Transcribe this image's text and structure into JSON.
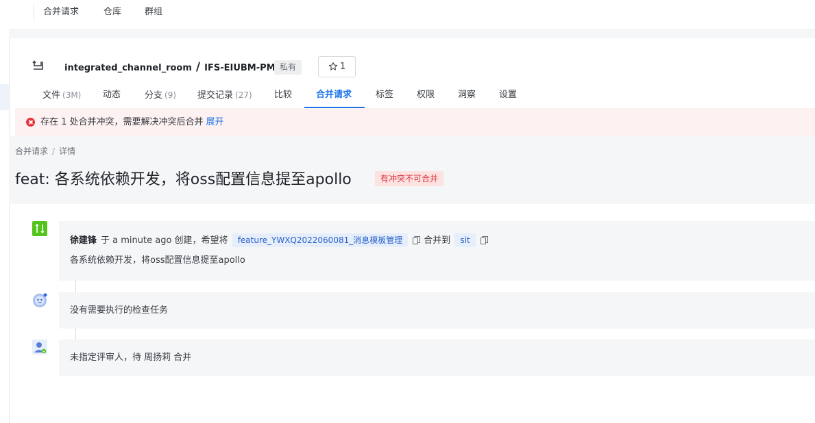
{
  "topnav": {
    "items": [
      "合并请求",
      "仓库",
      "群组"
    ]
  },
  "repo": {
    "group": "integrated_channel_room",
    "name": "IFS-EIUBM-PM",
    "visibility": "私有",
    "star_count": "1"
  },
  "tabs": [
    {
      "label": "文件",
      "count": "(3M)"
    },
    {
      "label": "动态",
      "count": ""
    },
    {
      "label": "分支",
      "count": "(9)"
    },
    {
      "label": "提交记录",
      "count": "(27)"
    },
    {
      "label": "比较",
      "count": ""
    },
    {
      "label": "合并请求",
      "count": "",
      "active": true
    },
    {
      "label": "标签",
      "count": ""
    },
    {
      "label": "权限",
      "count": ""
    },
    {
      "label": "洞察",
      "count": ""
    },
    {
      "label": "设置",
      "count": ""
    }
  ],
  "banner": {
    "message": "存在 1 处合并冲突，需要解决冲突后合并",
    "expand_label": "展开"
  },
  "breadcrumb": [
    "合并请求",
    "详情"
  ],
  "mr": {
    "title": "feat: 各系统依赖开发，将oss配置信息提至apollo",
    "status_tag": "有冲突不可合并",
    "author": "徐建锋",
    "created_text": "于 a minute ago 创建，希望将",
    "source_branch": "feature_YWXQ2022060081_消息模板管理",
    "merge_to_text": "合并到",
    "target_branch": "sit",
    "description": "各系统依赖开发，将oss配置信息提至apollo"
  },
  "timeline": {
    "checks_text": "没有需要执行的检查任务",
    "reviewers_text": "未指定评审人，待 周扬莉 合并"
  },
  "colors": {
    "accent": "#1a73e8",
    "conflict": "#d9363e",
    "mr_icon_bg": "#52c41a"
  }
}
